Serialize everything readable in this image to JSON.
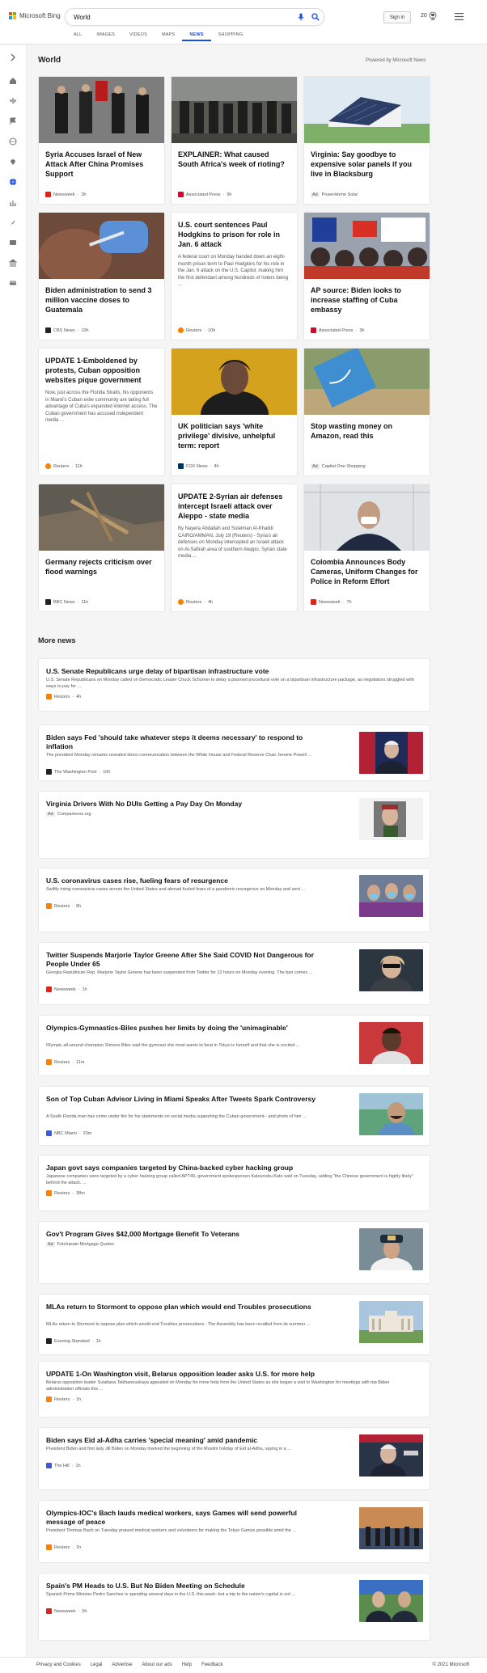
{
  "header": {
    "brand": "Microsoft Bing",
    "search_value": "World",
    "signin_label": "Sign in",
    "points": "20",
    "tabs": [
      {
        "label": "ALL"
      },
      {
        "label": "IMAGES"
      },
      {
        "label": "VIDEOS"
      },
      {
        "label": "MAPS"
      },
      {
        "label": "NEWS",
        "active": true
      },
      {
        "label": "SHOPPING"
      }
    ]
  },
  "section": {
    "title": "World",
    "powered_by": "Powered by Microsoft News"
  },
  "cards": [
    {
      "title": "Syria Accuses Israel of New Attack After China Promises Support",
      "source": "Newsweek",
      "time": "3h",
      "src_color": "#e2231a"
    },
    {
      "title": "EXPLAINER: What caused South Africa's week of rioting?",
      "source": "Associated Press",
      "time": "9h",
      "src_color": "#c8102e"
    },
    {
      "title": "Virginia: Say goodbye to expensive solar panels if you live in Blacksburg",
      "ad": "Ad",
      "source": "PowerHome Solar",
      "time": "",
      "src_color": "#2b6cb0"
    },
    {
      "title": "Biden administration to send 3 million vaccine doses to Guatemala",
      "source": "CBS News",
      "time": "10h",
      "src_color": "#222222"
    },
    {
      "title": "U.S. court sentences Paul Hodgkins to prison for role in Jan. 6 attack",
      "snippet": "A federal court on Monday handed down an eight-month prison term to Paul Hodgkins for his role in the Jan. 6 attack on the U.S. Capitol, making him the first defendant among hundreds of rioters being ...",
      "source": "Reuters",
      "time": "10h",
      "src_color": "#ff8000"
    },
    {
      "title": "AP source: Biden looks to increase staffing of Cuba embassy",
      "source": "Associated Press",
      "time": "3h",
      "src_color": "#c8102e"
    },
    {
      "title": "UPDATE 1-Emboldened by protests, Cuban opposition websites pique government",
      "snippet": "Now, just across the Florida Straits, his opponents in Miami's Cuban exile community are taking full advantage of Cuba's expanded internet access. The Cuban government has accused independent media ...",
      "source": "Reuters",
      "time": "11h",
      "src_color": "#ff8000"
    },
    {
      "title": "UK politician says 'white privilege' divisive, unhelpful term: report",
      "source": "FOX News",
      "time": "4h",
      "src_color": "#003366"
    },
    {
      "title": "Stop wasting money on Amazon, read this",
      "ad": "Ad",
      "source": "Capital One Shopping",
      "time": "",
      "src_color": "#004879"
    },
    {
      "title": "Germany rejects criticism over flood warnings",
      "source": "BBC News",
      "time": "11h",
      "src_color": "#222222"
    },
    {
      "title": "UPDATE 2-Syrian air defenses intercept Israeli attack over Aleppo - state media",
      "snippet": "By Nayera Abdallah and Suleiman Al-Khalidi CAIRO/AMMAN, July 19 (Reuters) - Syria's air defenses on Monday intercepted an Israeli attack on Al-Safirah area of southern Aleppo, Syrian state media ...",
      "source": "Reuters",
      "time": "4h",
      "src_color": "#ff8000"
    },
    {
      "title": "Colombia Announces Body Cameras, Uniform Changes for Police in Reform Effort",
      "source": "Newsweek",
      "time": "7h",
      "src_color": "#e2231a"
    }
  ],
  "more_news": {
    "title": "More news",
    "items": [
      {
        "title": "U.S. Senate Republicans urge delay of bipartisan infrastructure vote",
        "snippet": "U.S. Senate Republicans on Monday called on Democratic Leader Chuck Schumer to delay a planned procedural vote on a bipartisan infrastructure package, as negotiators struggled with ways to pay for ...",
        "source": "Reuters",
        "time": "4h",
        "src_color": "#ff8000"
      },
      {
        "title": "Biden says Fed 'should take whatever steps it deems necessary' to respond to inflation",
        "snippet": "The president Monday remarks revealed direct communication between the White House and Federal Reserve Chair Jerome Powell ...",
        "source": "The Washington Post",
        "time": "10h",
        "src_color": "#222222"
      },
      {
        "title": "Virginia Drivers With No DUIs Getting a Pay Day On Monday",
        "snippet": "",
        "ad": "Ad",
        "source": "Comparisons.org",
        "time": "",
        "src_color": "#888888"
      },
      {
        "title": "U.S. coronavirus cases rise, fueling fears of resurgence",
        "snippet": "Swiftly rising coronavirus cases across the United States and abroad fueled fears of a pandemic resurgence on Monday and sent ...",
        "source": "Reuters",
        "time": "8h",
        "src_color": "#ff8000"
      },
      {
        "title": "Twitter Suspends Marjorie Taylor Greene After She Said COVID Not Dangerous for People Under 65",
        "snippet": "Georgia Republican Rep. Marjorie Taylor Greene has been suspended from Twitter for 12 hours on Monday evening. The ban comes ...",
        "source": "Newsweek",
        "time": "1h",
        "src_color": "#e2231a"
      },
      {
        "title": "Olympics-Gymnastics-Biles pushes her limits by doing the 'unimaginable'",
        "snippet": "Olympic all-around champion Simone Biles said the gymnast she most wants to beat in Tokyo is herself and that she is excited ...",
        "source": "Reuters",
        "time": "11m",
        "src_color": "#ff8000"
      },
      {
        "title": "Son of Top Cuban Advisor Living in Miami Speaks After Tweets Spark Controversy",
        "snippet": "A South Florida man has come under fire for his statements on social media supporting the Cuban government-- and photo of him ...",
        "source": "NBC Miami",
        "time": "20m",
        "src_color": "#3b5bdb"
      },
      {
        "title": "Japan govt says companies targeted by China-backed cyber hacking group",
        "snippet": "Japanese companies were targeted by a cyber hacking group called APT40, government spokesperson Katsunobu Kato said on Tuesday, adding \"the Chinese government is highly likely\" behind the attack. ...",
        "source": "Reuters",
        "time": "38m",
        "src_color": "#ff8000"
      },
      {
        "title": "Gov't Program Gives $42,000 Mortgage Benefit To Veterans",
        "snippet": "",
        "ad": "Ad",
        "source": "Fetcharate Mortgage Quotes",
        "time": "",
        "src_color": "#888888"
      },
      {
        "title": "MLAs return to Stormont to oppose plan which would end Troubles prosecutions",
        "snippet": "MLAs return to Stormont to oppose plan which would end Troubles prosecutions - The Assembly has been recalled from its summer ...",
        "source": "Evening Standard",
        "time": "1h",
        "src_color": "#222222"
      },
      {
        "title": "UPDATE 1-On Washington visit, Belarus opposition leader asks U.S. for more help",
        "snippet": "Belarus opposition leader Sviatlana Tsikhanouskaya appealed on Monday for more help from the United States as she began a visit to Washington for meetings with top Biden administration officials this ...",
        "source": "Reuters",
        "time": "1h",
        "src_color": "#ff8000"
      },
      {
        "title": "Biden says Eid al-Adha carries 'special meaning' amid pandemic",
        "snippet": "President Biden and first lady Jill Biden on Monday marked the beginning of the Muslim holiday of Eid al-Adha, saying in a ...",
        "source": "The Hill",
        "time": "1h",
        "src_color": "#3b5bdb"
      },
      {
        "title": "Olympics-IOC's Bach lauds medical workers, says Games will send powerful message of peace",
        "snippet": "President Thomas Bach on Tuesday praised medical workers and volunteers for making the Tokyo Games possible amid the ...",
        "source": "Reuters",
        "time": "1h",
        "src_color": "#ff8000"
      },
      {
        "title": "Spain's PM Heads to U.S. But No Biden Meeting on Schedule",
        "snippet": "Spanish Prime Minister Pedro Sanchez is spending several days in the U.S. this week--but a trip to the nation's capital is not ...",
        "source": "Newsweek",
        "time": "5h",
        "src_color": "#e2231a"
      }
    ]
  },
  "footer": {
    "links": [
      "Privacy and Cookies",
      "Legal",
      "Advertise",
      "About our ads",
      "Help",
      "Feedback"
    ],
    "copyright": "© 2021 Microsoft"
  }
}
